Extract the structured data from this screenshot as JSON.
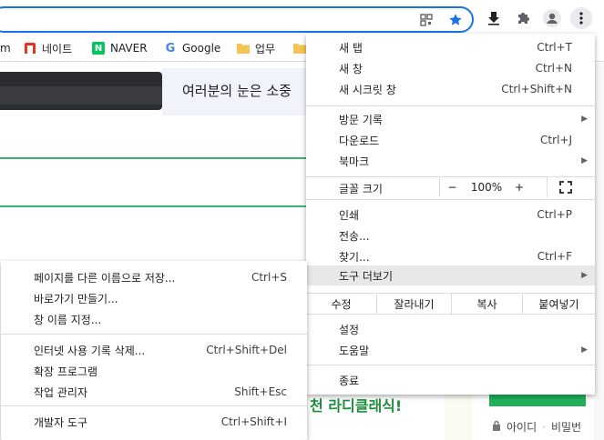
{
  "bookmarks": [
    {
      "label": "네이트"
    },
    {
      "label": "NAVER"
    },
    {
      "label": "Google"
    },
    {
      "label": "업무"
    }
  ],
  "bookmark_partial": "m",
  "content": {
    "banner_text": "여러분의 눈은 소중",
    "promo_text": "천 라디클래식!",
    "login_id": "아이디",
    "login_sep": "·",
    "login_pw": "비밀번"
  },
  "menu": {
    "new_tab": {
      "label": "새 탭",
      "shortcut": "Ctrl+T"
    },
    "new_window": {
      "label": "새 창",
      "shortcut": "Ctrl+N"
    },
    "incognito": {
      "label": "새 시크릿 창",
      "shortcut": "Ctrl+Shift+N"
    },
    "history": {
      "label": "방문 기록"
    },
    "downloads": {
      "label": "다운로드",
      "shortcut": "Ctrl+J"
    },
    "bookmarks": {
      "label": "북마크"
    },
    "zoom": {
      "label": "글꼴 크기",
      "minus": "−",
      "value": "100%",
      "plus": "+"
    },
    "print": {
      "label": "인쇄",
      "shortcut": "Ctrl+P"
    },
    "cast": {
      "label": "전송..."
    },
    "find": {
      "label": "찾기...",
      "shortcut": "Ctrl+F"
    },
    "more_tools": {
      "label": "도구 더보기"
    },
    "edit": {
      "label": "수정",
      "cut": "잘라내기",
      "copy": "복사",
      "paste": "붙여넣기"
    },
    "settings": {
      "label": "설정"
    },
    "help": {
      "label": "도움말"
    },
    "exit": {
      "label": "종료"
    }
  },
  "submenu": {
    "save_as": {
      "label": "페이지를 다른 이름으로 저장...",
      "shortcut": "Ctrl+S"
    },
    "create_shortcut": {
      "label": "바로가기 만들기..."
    },
    "name_window": {
      "label": "창 이름 지정..."
    },
    "clear_data": {
      "label": "인터넷 사용 기록 삭제...",
      "shortcut": "Ctrl+Shift+Del"
    },
    "extensions": {
      "label": "확장 프로그램"
    },
    "task_manager": {
      "label": "작업 관리자",
      "shortcut": "Shift+Esc"
    },
    "dev_tools": {
      "label": "개발자 도구",
      "shortcut": "Ctrl+Shift+I"
    }
  },
  "colors": {
    "accent": "#1a73e8",
    "highlight": "#e8e8e9",
    "green": "#3cb371"
  }
}
